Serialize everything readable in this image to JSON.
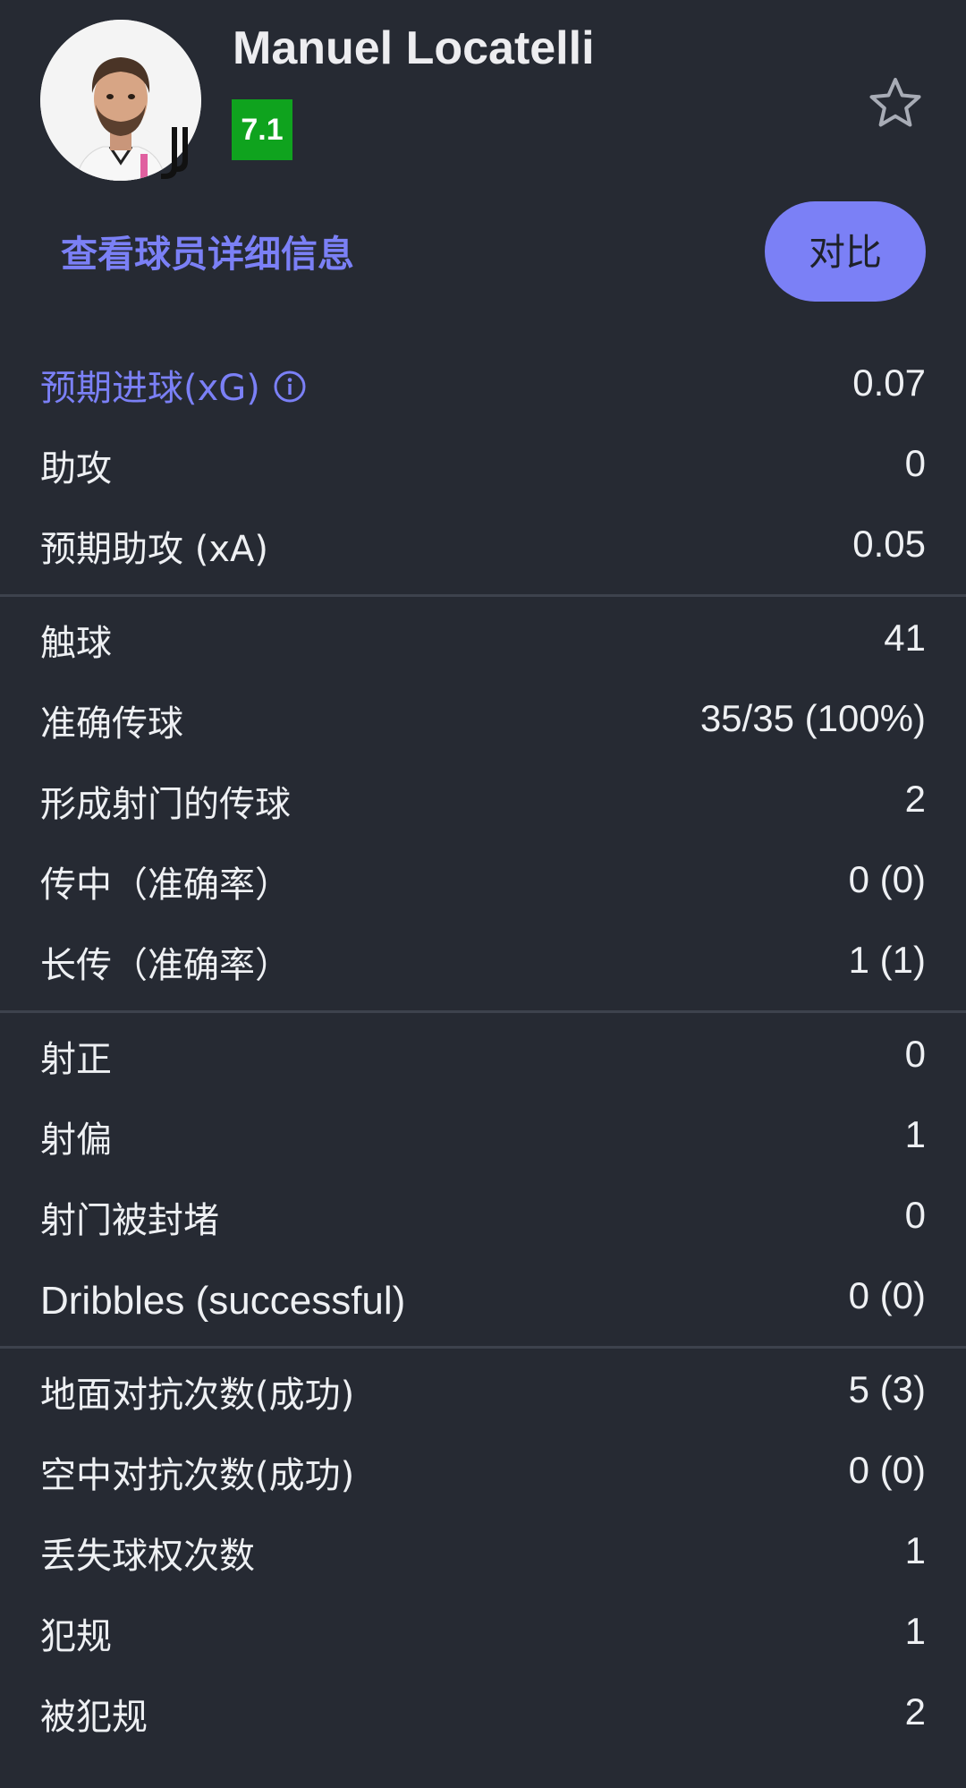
{
  "player": {
    "name": "Manuel Locatelli",
    "rating": "7.1",
    "detail_link": "查看球员详细信息",
    "compare_label": "对比"
  },
  "colors": {
    "background": "#262a33",
    "accent": "#7b80f6",
    "rating_green": "#0fa31e",
    "divider": "#3d424d"
  },
  "icons": {
    "favorite": "star-outline-icon",
    "info": "info-circle-icon"
  },
  "stats_groups": [
    {
      "rows": [
        {
          "label": "预期进球(xG)",
          "value": "0.07"
        },
        {
          "label": "助攻",
          "value": "0"
        },
        {
          "label": "预期助攻 (xA)",
          "value": "0.05"
        }
      ]
    },
    {
      "rows": [
        {
          "label": "触球",
          "value": "41"
        },
        {
          "label": "准确传球",
          "value": "35/35 (100%)"
        },
        {
          "label": "形成射门的传球",
          "value": "2"
        },
        {
          "label": "传中（准确率）",
          "value": "0 (0)"
        },
        {
          "label": "长传（准确率）",
          "value": "1 (1)"
        }
      ]
    },
    {
      "rows": [
        {
          "label": "射正",
          "value": "0"
        },
        {
          "label": "射偏",
          "value": "1"
        },
        {
          "label": "射门被封堵",
          "value": "0"
        },
        {
          "label": "Dribbles (successful)",
          "value": "0 (0)"
        }
      ]
    },
    {
      "rows": [
        {
          "label": "地面对抗次数(成功)",
          "value": "5 (3)"
        },
        {
          "label": "空中对抗次数(成功)",
          "value": "0 (0)"
        },
        {
          "label": "丢失球权次数",
          "value": "1"
        },
        {
          "label": "犯规",
          "value": "1"
        },
        {
          "label": "被犯规",
          "value": "2"
        }
      ]
    }
  ]
}
